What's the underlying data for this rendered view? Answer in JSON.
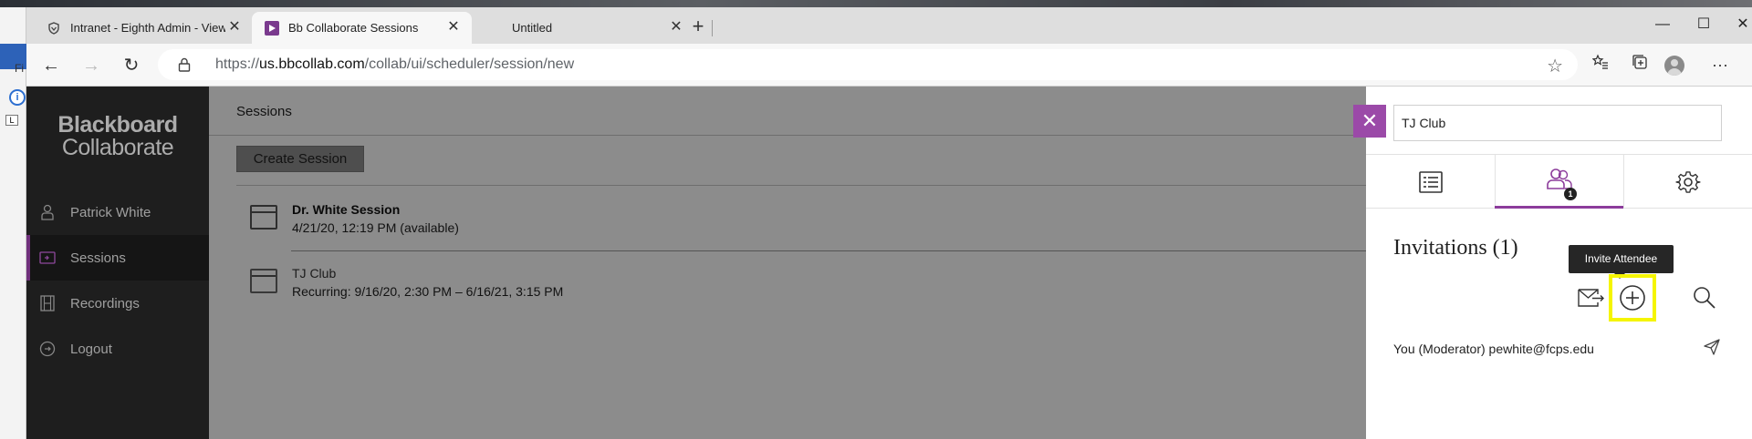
{
  "browser": {
    "tabs": [
      {
        "label": "Intranet - Eighth Admin - View R",
        "active": false
      },
      {
        "label": "Bb Collaborate Sessions",
        "active": true
      },
      {
        "label": "Untitled",
        "active": false
      }
    ],
    "url_host": "us.bbcollab.com",
    "url_prefix": "https://",
    "url_path": "/collab/ui/scheduler/session/new"
  },
  "desktop": {
    "left_text": "Fi"
  },
  "app": {
    "logo_line1": "Blackboard",
    "logo_line2": "Collaborate",
    "nav": [
      {
        "label": "Patrick White",
        "icon": "user-icon"
      },
      {
        "label": "Sessions",
        "icon": "sessions-icon",
        "active": true
      },
      {
        "label": "Recordings",
        "icon": "film-icon"
      },
      {
        "label": "Logout",
        "icon": "logout-icon"
      }
    ],
    "main_title": "Sessions",
    "create_button": "Create Session",
    "sessions": [
      {
        "title": "Dr. White Session",
        "subtitle": "4/21/20, 12:19 PM (available)"
      },
      {
        "title": "TJ Club",
        "subtitle": "Recurring: 9/16/20, 2:30 PM – 6/16/21, 3:15 PM"
      }
    ]
  },
  "panel": {
    "session_name": "TJ Club",
    "attendee_count": "1",
    "invitations_heading": "Invitations (1)",
    "tooltip": "Invite Attendee",
    "invitee": "You (Moderator) pewhite@fcps.edu",
    "accent": "#8c3c9b",
    "highlight": "#f5f500"
  }
}
